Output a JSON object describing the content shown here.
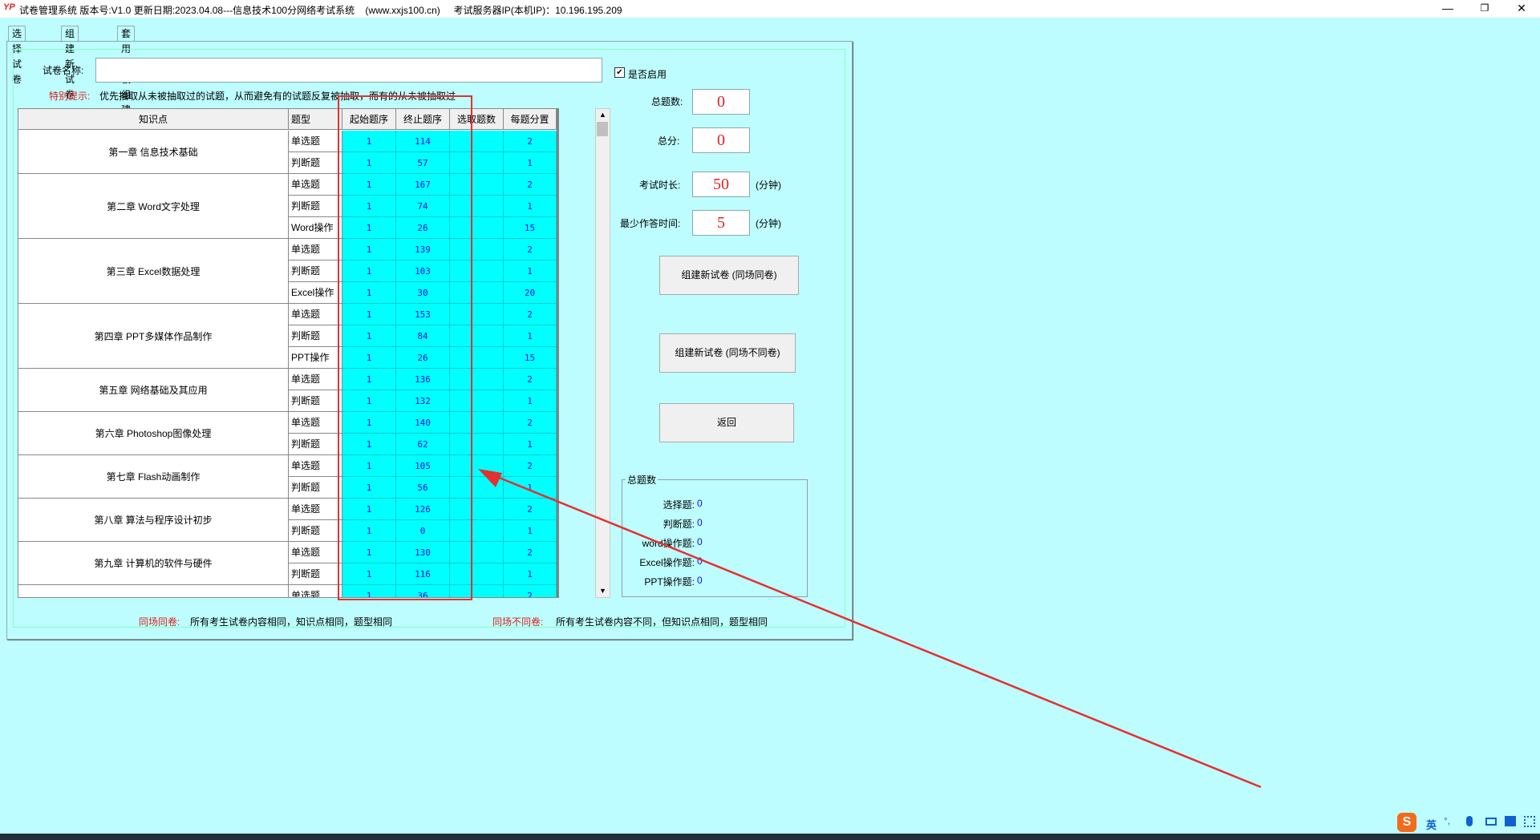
{
  "window": {
    "app_icon": "YP",
    "title": "试卷管理系统 版本号:V1.0 更新日期:2023.04.08---信息技术100分网络考试系统    (www.xxjs100.cn)     考试服务器IP(本机IP)：10.196.195.209",
    "controls": {
      "minimize": "—",
      "restore": "❐",
      "close": "✕"
    }
  },
  "tabs": [
    {
      "label": "选择试卷"
    },
    {
      "label": "组建新试卷"
    },
    {
      "label": "套用模板组建新试卷"
    }
  ],
  "form": {
    "name_label": "试卷名称:",
    "name_value": "",
    "enabled_label": "是否启用",
    "enabled_check": "✔",
    "tip_label": "特别提示:",
    "tip_text": "优先抽取从未被抽取过的试题，从而避免有的试题反复被抽取，而有的从未被抽取过"
  },
  "grid": {
    "headers": [
      "知识点",
      "题型",
      "起始题序",
      "终止题序",
      "选取题数",
      "每题分置"
    ],
    "chapters": [
      {
        "name": "第一章 信息技术基础",
        "rows": [
          {
            "type": "单选题",
            "start": "1",
            "end": "114",
            "pick": "",
            "score": "2"
          },
          {
            "type": "判断题",
            "start": "1",
            "end": "57",
            "pick": "",
            "score": "1"
          }
        ]
      },
      {
        "name": "第二章 Word文字处理",
        "rows": [
          {
            "type": "单选题",
            "start": "1",
            "end": "167",
            "pick": "",
            "score": "2"
          },
          {
            "type": "判断题",
            "start": "1",
            "end": "74",
            "pick": "",
            "score": "1"
          },
          {
            "type": "Word操作",
            "start": "1",
            "end": "26",
            "pick": "",
            "score": "15"
          }
        ]
      },
      {
        "name": "第三章 Excel数据处理",
        "rows": [
          {
            "type": "单选题",
            "start": "1",
            "end": "139",
            "pick": "",
            "score": "2"
          },
          {
            "type": "判断题",
            "start": "1",
            "end": "103",
            "pick": "",
            "score": "1"
          },
          {
            "type": "Excel操作",
            "start": "1",
            "end": "30",
            "pick": "",
            "score": "20"
          }
        ]
      },
      {
        "name": "第四章 PPT多媒体作品制作",
        "rows": [
          {
            "type": "单选题",
            "start": "1",
            "end": "153",
            "pick": "",
            "score": "2"
          },
          {
            "type": "判断题",
            "start": "1",
            "end": "84",
            "pick": "",
            "score": "1"
          },
          {
            "type": "PPT操作",
            "start": "1",
            "end": "26",
            "pick": "",
            "score": "15"
          }
        ]
      },
      {
        "name": "第五章 网络基础及其应用",
        "rows": [
          {
            "type": "单选题",
            "start": "1",
            "end": "136",
            "pick": "",
            "score": "2"
          },
          {
            "type": "判断题",
            "start": "1",
            "end": "132",
            "pick": "",
            "score": "1"
          }
        ]
      },
      {
        "name": "第六章 Photoshop图像处理",
        "rows": [
          {
            "type": "单选题",
            "start": "1",
            "end": "140",
            "pick": "",
            "score": "2"
          },
          {
            "type": "判断题",
            "start": "1",
            "end": "62",
            "pick": "",
            "score": "1"
          }
        ]
      },
      {
        "name": "第七章 Flash动画制作",
        "rows": [
          {
            "type": "单选题",
            "start": "1",
            "end": "105",
            "pick": "",
            "score": "2"
          },
          {
            "type": "判断题",
            "start": "1",
            "end": "56",
            "pick": "",
            "score": "1"
          }
        ]
      },
      {
        "name": "第八章 算法与程序设计初步",
        "rows": [
          {
            "type": "单选题",
            "start": "1",
            "end": "126",
            "pick": "",
            "score": "2"
          },
          {
            "type": "判断题",
            "start": "1",
            "end": "0",
            "pick": "",
            "score": "1"
          }
        ]
      },
      {
        "name": "第九章 计算机的软件与硬件",
        "rows": [
          {
            "type": "单选题",
            "start": "1",
            "end": "130",
            "pick": "",
            "score": "2"
          },
          {
            "type": "判断题",
            "start": "1",
            "end": "116",
            "pick": "",
            "score": "1"
          }
        ]
      },
      {
        "name": "",
        "rows": [
          {
            "type": "单选题",
            "start": "1",
            "end": "36",
            "pick": "",
            "score": "2"
          }
        ]
      }
    ]
  },
  "stats": {
    "total_count_label": "总题数:",
    "total_count": "0",
    "total_score_label": "总分:",
    "total_score": "0",
    "duration_label": "考试时长:",
    "duration": "50",
    "duration_unit": "(分钟)",
    "min_time_label": "最少作答时间:",
    "min_time": "5",
    "min_time_unit": "(分钟)"
  },
  "buttons": {
    "same_paper": "组建新试卷 (同场同卷)",
    "diff_paper": "组建新试卷 (同场不同卷)",
    "back": "返回"
  },
  "summary": {
    "title": "总题数",
    "items": [
      {
        "label": "选择题:",
        "value": "0"
      },
      {
        "label": "判断题:",
        "value": "0"
      },
      {
        "label": "word操作题:",
        "value": "0"
      },
      {
        "label": "Excel操作题:",
        "value": "0"
      },
      {
        "label": "PPT操作题:",
        "value": "0"
      }
    ]
  },
  "footer": {
    "same_label": "同场同卷:",
    "same_text": "所有考生试卷内容相同，知识点相同，题型相同",
    "diff_label": "同场不同卷:",
    "diff_text": "所有考生试卷内容不同，但知识点相同，题型相同"
  },
  "ime": {
    "logo": "S",
    "lang": "英",
    "punct": "°,",
    "icons": [
      "mic-icon",
      "keyboard-icon",
      "shirt-icon",
      "grid-icon"
    ]
  },
  "colors": {
    "background": "#bdfdff",
    "highlight": "#e53030",
    "cell_text": "#1010e0",
    "cell_bg": "#00ffff"
  }
}
